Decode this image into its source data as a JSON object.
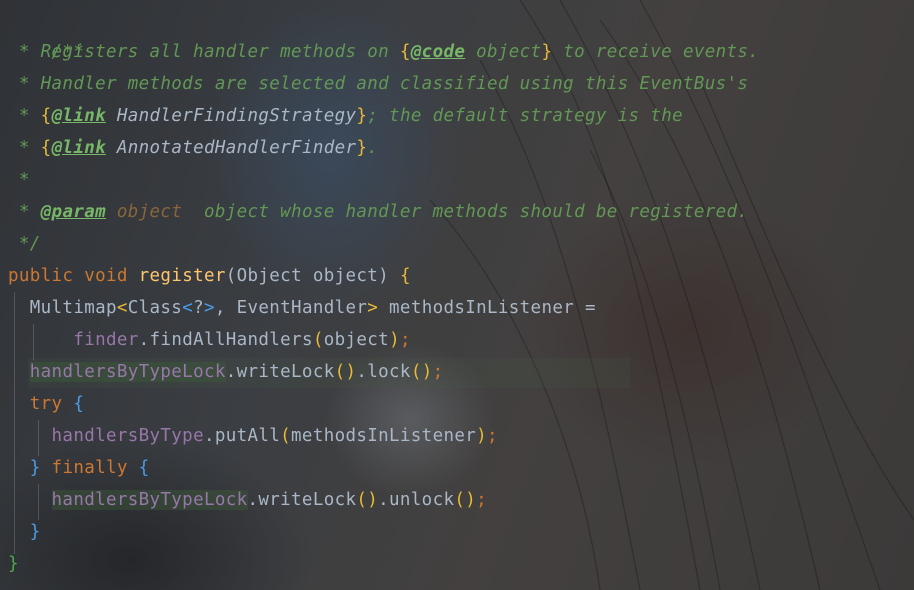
{
  "code": {
    "doc_open": "/**",
    "doc1_pre": " * Registers all handler methods on ",
    "doc1_brace_open": "{",
    "doc1_tag": "@code",
    "doc1_arg": " object",
    "doc1_brace_close": "}",
    "doc1_post": " to receive events.",
    "doc2": " * Handler methods are selected and classified using this EventBus's",
    "doc3_pre": " * ",
    "doc3_brace_open": "{",
    "doc3_tag": "@link",
    "doc3_arg": " HandlerFindingStrategy",
    "doc3_brace_close": "}",
    "doc3_post": "; the default strategy is the",
    "doc4_pre": " * ",
    "doc4_brace_open": "{",
    "doc4_tag": "@link",
    "doc4_arg": " AnnotatedHandlerFinder",
    "doc4_brace_close": "}",
    "doc4_post": ".",
    "doc5": " *",
    "doc6_pre": " * ",
    "doc6_tag": "@param",
    "doc6_param": " object",
    "doc6_post": "  object whose handler methods should be registered.",
    "doc_close": " */",
    "sig_public": "public",
    "sig_void": " void ",
    "sig_name": "register",
    "sig_params": "(Object object) ",
    "sig_open": "{",
    "l1_type": "  Multimap",
    "l1_lt": "<",
    "l1_class": "Class",
    "l1_lt2": "<",
    "l1_q": "?",
    "l1_gt2": ">",
    "l1_rest": ", EventHandler",
    "l1_gt": ">",
    "l1_var": " methodsInListener =",
    "l2_indent": "      ",
    "l2_field": "finder",
    "l2_call": ".findAllHandlers",
    "l2_po": "(",
    "l2_arg": "object",
    "l2_pc": ")",
    "l2_semi": ";",
    "l3_indent": "  ",
    "l3_field": "handlersByTypeLock",
    "l3_call": ".writeLock",
    "l3_p1": "()",
    "l3_call2": ".lock",
    "l3_p2": "()",
    "l3_semi": ";",
    "l4_try": "  try ",
    "l4_open": "{",
    "l5_indent": "    ",
    "l5_field": "handlersByType",
    "l5_call": ".putAll",
    "l5_po": "(",
    "l5_arg": "methodsInListener",
    "l5_pc": ")",
    "l5_semi": ";",
    "l6_indent": "  ",
    "l6_close": "}",
    "l6_finally": " finally ",
    "l6_open": "{",
    "l7_indent": "    ",
    "l7_field": "handlersByTypeLock",
    "l7_call": ".writeLock",
    "l7_p1": "()",
    "l7_call2": ".unlock",
    "l7_p2": "()",
    "l7_semi": ";",
    "l8_indent": "  ",
    "l8_close": "}",
    "l9_close": "}"
  }
}
